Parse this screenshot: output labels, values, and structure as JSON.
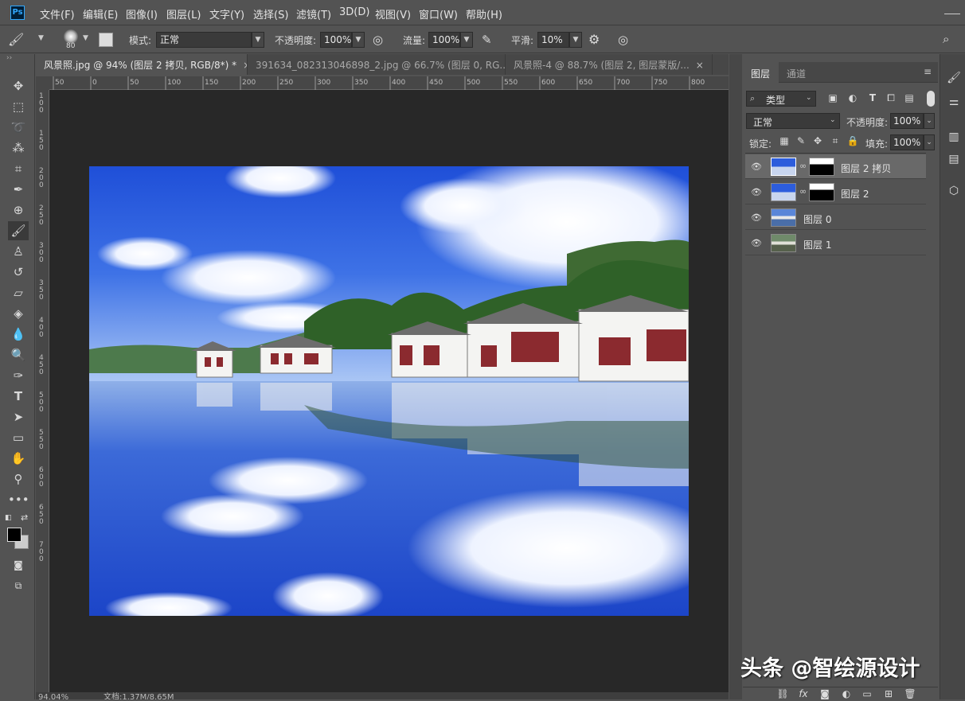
{
  "menu": {
    "items": [
      "文件(F)",
      "编辑(E)",
      "图像(I)",
      "图层(L)",
      "文字(Y)",
      "选择(S)",
      "滤镜(T)",
      "3D(D)",
      "视图(V)",
      "窗口(W)",
      "帮助(H)"
    ]
  },
  "options": {
    "brush_size": "80",
    "mode_label": "模式:",
    "mode_value": "正常",
    "opacity_label": "不透明度:",
    "opacity_value": "100%",
    "flow_label": "流量:",
    "flow_value": "100%",
    "smooth_label": "平滑:",
    "smooth_value": "10%"
  },
  "tabs": [
    {
      "title": "风景照.jpg @ 94% (图层 2 拷贝, RGB/8*) *",
      "active": true
    },
    {
      "title": "391634_082313046898_2.jpg @ 66.7% (图层 0, RG...",
      "active": false
    },
    {
      "title": "风景照-4 @ 88.7% (图层 2, 图层蒙版/...",
      "active": false
    }
  ],
  "ruler": {
    "top": [
      "50",
      "0",
      "50",
      "100",
      "150",
      "200",
      "250",
      "300",
      "350",
      "400",
      "450",
      "500",
      "550",
      "600",
      "650",
      "700",
      "750",
      "800"
    ],
    "left": [
      "1 0 0",
      "1 5 0",
      "2 0 0",
      "2 5 0",
      "3 0 0",
      "3 5 0",
      "4 0 0",
      "4 5 0",
      "5 0 0",
      "5 5 0",
      "6 0 0",
      "6 5 0",
      "7 0 0"
    ]
  },
  "status": {
    "zoom": "94.04%",
    "doc": "文档:1.37M/8.65M"
  },
  "layers_panel": {
    "tab_layers": "图层",
    "tab_channels": "通道",
    "filter_label": "类型",
    "blend_mode": "正常",
    "opacity_label": "不透明度:",
    "opacity_value": "100%",
    "lock_label": "锁定:",
    "fill_label": "填充:",
    "fill_value": "100%",
    "layers": [
      {
        "name": "图层 2 拷贝",
        "selected": true,
        "has_mask": true
      },
      {
        "name": "图层 2",
        "selected": false,
        "has_mask": true
      },
      {
        "name": "图层 0",
        "selected": false,
        "has_mask": false
      },
      {
        "name": "图层 1",
        "selected": false,
        "has_mask": false
      }
    ]
  },
  "watermark": "头条 @智绘源设计",
  "colors": {
    "ui_bg": "#535353",
    "workspace": "#282828",
    "ps_blue": "#31a8ff",
    "sky": "#1a4fd0"
  }
}
